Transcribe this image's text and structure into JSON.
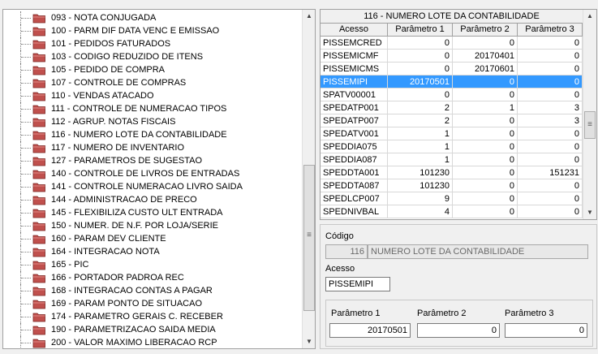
{
  "tree": {
    "items": [
      "093 - NOTA CONJUGADA",
      "100 - PARM DIF DATA VENC E EMISSAO",
      "101 - PEDIDOS FATURADOS",
      "103 - CODIGO REDUZIDO DE ITENS",
      "105 - PEDIDO DE COMPRA",
      "107 - CONTROLE DE COMPRAS",
      "110 - VENDAS ATACADO",
      "111 - CONTROLE DE NUMERACAO TIPOS",
      "112 - AGRUP. NOTAS FISCAIS",
      "116 - NUMERO LOTE DA CONTABILIDADE",
      "117 - NUMERO DE INVENTARIO",
      "127 - PARAMETROS DE SUGESTAO",
      "140 - CONTROLE DE LIVROS DE ENTRADAS",
      "141 - CONTROLE NUMERACAO LIVRO SAIDA",
      "144 - ADMINISTRACAO DE PRECO",
      "145 - FLEXIBILIZA CUSTO ULT ENTRADA",
      "150 - NUMER. DE N.F. POR LOJA/SERIE",
      "160 - PARAM DEV CLIENTE",
      "164 - INTEGRACAO NOTA",
      "165 - PIC",
      "166 - PORTADOR PADROA REC",
      "168 - INTEGRACAO CONTAS A PAGAR",
      "169 - PARAM PONTO DE SITUACAO",
      "174 - PARAMETRO GERAIS C. RECEBER",
      "190 - PARAMETRIZACAO SAIDA MEDIA",
      "200 - VALOR MAXIMO LIBERACAO RCP"
    ],
    "scroll_up": "▲",
    "scroll_down": "▼",
    "scroll_grip": "≡"
  },
  "grid": {
    "title": "116 - NUMERO LOTE DA CONTABILIDADE",
    "columns": [
      "Acesso",
      "Parâmetro 1",
      "Parâmetro 2",
      "Parâmetro 3"
    ],
    "rows": [
      [
        "PISSEMCRED",
        "0",
        "0",
        "0"
      ],
      [
        "PISSEMICMF",
        "0",
        "20170401",
        "0"
      ],
      [
        "PISSEMICMS",
        "0",
        "20170601",
        "0"
      ],
      [
        "PISSEMIPI",
        "20170501",
        "0",
        "0"
      ],
      [
        "SPATV00001",
        "0",
        "0",
        "0"
      ],
      [
        "SPEDATP001",
        "2",
        "1",
        "3"
      ],
      [
        "SPEDATP007",
        "2",
        "0",
        "3"
      ],
      [
        "SPEDATV001",
        "1",
        "0",
        "0"
      ],
      [
        "SPEDDIA075",
        "1",
        "0",
        "0"
      ],
      [
        "SPEDDIA087",
        "1",
        "0",
        "0"
      ],
      [
        "SPEDDTA001",
        "101230",
        "0",
        "151231"
      ],
      [
        "SPEDDTA087",
        "101230",
        "0",
        "0"
      ],
      [
        "SPEDLCP007",
        "9",
        "0",
        "0"
      ],
      [
        "SPEDNIVBAL",
        "4",
        "0",
        "0"
      ]
    ],
    "selected_row": 3,
    "scroll_up": "▲",
    "scroll_down": "▼",
    "scroll_grip": "≡"
  },
  "form": {
    "codigo_label": "Código",
    "codigo_value": "116",
    "descricao_value": "NUMERO LOTE DA CONTABILIDADE",
    "acesso_label": "Acesso",
    "acesso_value": "PISSEMIPI",
    "param1_label": "Parâmetro 1",
    "param1_value": "20170501",
    "param2_label": "Parâmetro 2",
    "param2_value": "0",
    "param3_label": "Parâmetro 3",
    "param3_value": "0"
  },
  "colors": {
    "folder": "#c0504d",
    "selection": "#3399ff"
  }
}
